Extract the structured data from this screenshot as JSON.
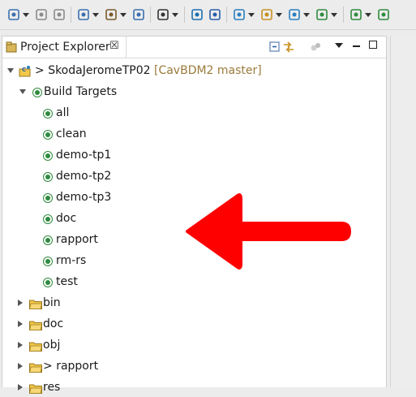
{
  "toolbar": {
    "buttons": [
      {
        "name": "new-wizard-icon",
        "dropdown": true
      },
      {
        "name": "save-icon",
        "dropdown": false
      },
      {
        "name": "save-all-icon",
        "dropdown": false
      },
      {
        "name": "build-settings-icon",
        "dropdown": true
      },
      {
        "name": "hammer-build-icon",
        "dropdown": true
      },
      {
        "name": "binary-icon",
        "dropdown": false
      },
      {
        "name": "debug-config-icon",
        "dropdown": true
      },
      {
        "name": "console-icon",
        "dropdown": false
      },
      {
        "name": "skip-breakpoints-icon",
        "dropdown": false
      },
      {
        "name": "new-project-icon",
        "dropdown": true
      },
      {
        "name": "new-folder-icon",
        "dropdown": true
      },
      {
        "name": "new-class-icon",
        "dropdown": true
      },
      {
        "name": "refresh-run-icon",
        "dropdown": true
      },
      {
        "name": "bug-debug-icon",
        "dropdown": true
      },
      {
        "name": "run-icon",
        "dropdown": false
      }
    ]
  },
  "view": {
    "tab_label": "Project Explorer",
    "close_glyph": "☒",
    "tools": [
      "collapse-all-icon",
      "link-editor-icon",
      "filter-icon"
    ]
  },
  "tree": {
    "project": {
      "name": "SkodaJeromeTP02",
      "prefix": "> ",
      "decoration": "[CavBDM2 master]"
    },
    "build_targets_label": "Build Targets",
    "targets": [
      "all",
      "clean",
      "demo-tp1",
      "demo-tp2",
      "demo-tp3",
      "doc",
      "rapport",
      "rm-rs",
      "test"
    ],
    "folders": [
      {
        "label": "bin",
        "prefix": ""
      },
      {
        "label": "doc",
        "prefix": ""
      },
      {
        "label": "obj",
        "prefix": ""
      },
      {
        "label": "rapport",
        "prefix": "> "
      },
      {
        "label": "res",
        "prefix": ""
      }
    ]
  },
  "annotation": {
    "shape": "red-arrow-left",
    "color": "#ff0000"
  }
}
